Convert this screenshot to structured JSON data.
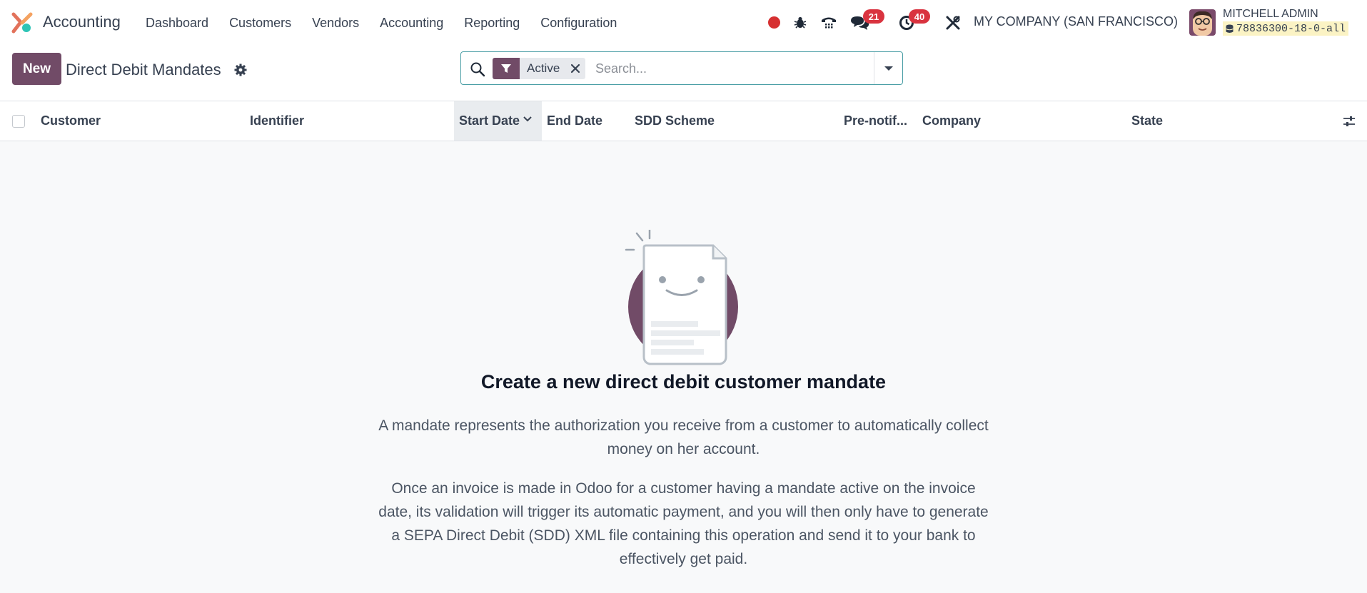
{
  "navbar": {
    "app_name": "Accounting",
    "menu": [
      "Dashboard",
      "Customers",
      "Vendors",
      "Accounting",
      "Reporting",
      "Configuration"
    ],
    "messages_badge": "21",
    "activities_badge": "40",
    "company": "MY COMPANY (SAN FRANCISCO)",
    "user_name": "MITCHELL ADMIN",
    "database": "78836300-18-0-all",
    "brand_color": "#714b67",
    "record_color": "#d63031"
  },
  "control_panel": {
    "new_label": "New",
    "title": "Direct Debit Mandates",
    "search": {
      "facet_label": "Active",
      "placeholder": "Search..."
    }
  },
  "table": {
    "columns": [
      "Customer",
      "Identifier",
      "Start Date",
      "End Date",
      "SDD Scheme",
      "Pre-notif...",
      "Company",
      "State"
    ],
    "sorted_column": "Start Date"
  },
  "empty_state": {
    "title": "Create a new direct debit customer mandate",
    "paragraph_1": "A mandate represents the authorization you receive from a customer to automatically collect money on her account.",
    "paragraph_2": "Once an invoice is made in Odoo for a customer having a mandate active on the invoice date, its validation will trigger its automatic payment, and you will then only have to generate a SEPA Direct Debit (SDD) XML file containing this operation and send it to your bank to effectively get paid."
  }
}
